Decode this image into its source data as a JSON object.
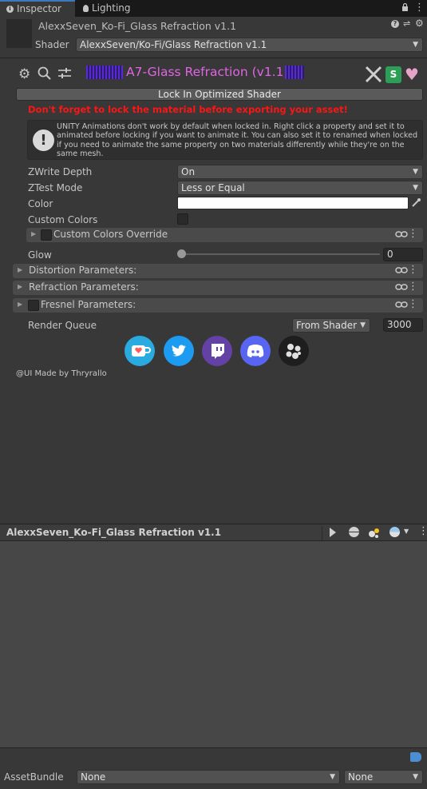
{
  "tabs": [
    {
      "label": "Inspector",
      "icon": "info-icon"
    },
    {
      "label": "Lighting",
      "icon": "bulb-icon"
    }
  ],
  "header": {
    "title": "AlexxSeven_Ko-Fi_Glass Refraction v1.1",
    "shader_label": "Shader",
    "shader_value": "AlexxSeven/Ko-Fi/Glass Refraction v1.1"
  },
  "banner": {
    "title": "A7-Glass Refraction (v1.1)",
    "title_color": "#e264e6"
  },
  "lock_button": "Lock In Optimized Shader",
  "warning": "Don't forget to lock the material before exporting your asset!",
  "help_text": "UNITY Animations don't work by default when locked in. Right click a property and set it to animated before locking if you want to animate it. You can also set it to renamed when locked if you need to animate the same property on two materials differently while they're on the same mesh.",
  "properties": {
    "zwrite": {
      "label": "ZWrite Depth",
      "value": "On"
    },
    "ztest": {
      "label": "ZTest Mode",
      "value": "Less or Equal"
    },
    "color": {
      "label": "Color",
      "value": "#ffffff"
    },
    "custom_colors": {
      "label": "Custom Colors",
      "checked": false
    },
    "custom_override": {
      "label": "Custom Colors Override",
      "checked": false
    },
    "glow": {
      "label": "Glow",
      "value": "0",
      "fraction": 0.0
    }
  },
  "sections": [
    {
      "label": "Distortion Parameters:"
    },
    {
      "label": "Refraction Parameters:"
    },
    {
      "label": "Fresnel Parameters:",
      "checked": false
    }
  ],
  "render_queue": {
    "label": "Render Queue",
    "mode": "From Shader",
    "value": "3000"
  },
  "socials": [
    {
      "icon": "kofi-icon",
      "color": "#29abe0"
    },
    {
      "icon": "twitter-icon",
      "color": "#1d9bf0"
    },
    {
      "icon": "twitch-icon",
      "color": "#6441a5"
    },
    {
      "icon": "discord-icon",
      "color": "#5865f2"
    },
    {
      "icon": "github-icon",
      "color": "#1e1e1e"
    }
  ],
  "credit": "@UI Made by Thryrallo",
  "preview": {
    "title": "AlexxSeven_Ko-Fi_Glass Refraction v1.1"
  },
  "asset_bundle": {
    "label": "AssetBundle",
    "name": "None",
    "variant": "None"
  }
}
